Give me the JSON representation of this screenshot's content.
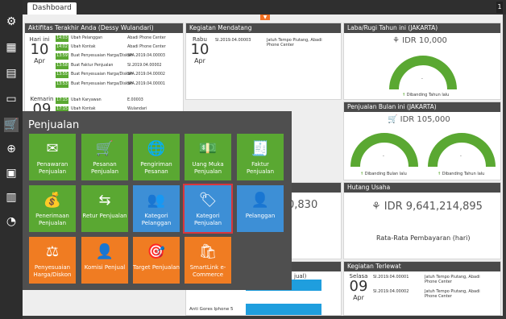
{
  "window": {
    "tab_label": "Dashboard",
    "collapse_glyph": "▼",
    "side_glyph": "1"
  },
  "sidebar": {
    "items": [
      {
        "name": "settings-icon",
        "glyph": "⚙"
      },
      {
        "name": "building-icon",
        "glyph": "▦"
      },
      {
        "name": "calculator-icon",
        "glyph": "▤"
      },
      {
        "name": "wallet-icon",
        "glyph": "▭"
      },
      {
        "name": "cart-icon",
        "glyph": "🛒"
      },
      {
        "name": "cart-add-icon",
        "glyph": "⊕"
      },
      {
        "name": "archive-icon",
        "glyph": "▣"
      },
      {
        "name": "branch-icon",
        "glyph": "▥"
      },
      {
        "name": "pie-chart-icon",
        "glyph": "◔"
      }
    ]
  },
  "activity": {
    "title": "Aktifitas Terakhir Anda (Dessy Wulandari)",
    "day1": {
      "name": "Hari ini",
      "day": "10",
      "month": "Apr"
    },
    "day2": {
      "name": "Kemarin",
      "day": "09",
      "month": "Apr"
    },
    "rows1": [
      {
        "time": "14:03",
        "action": "Ubah Pelanggan",
        "ref": "Abadi Phone Center"
      },
      {
        "time": "14:02",
        "action": "Ubah Kontak",
        "ref": "Abadi Phone Center"
      },
      {
        "time": "13:59",
        "action": "Buat Penyesuaian Harga/Diskon",
        "ref": "SPA.2019.04.00003"
      },
      {
        "time": "13:58",
        "action": "Buat Faktur Penjualan",
        "ref": "SI.2019.04.00002"
      },
      {
        "time": "13:55",
        "action": "Buat Penyesuaian Harga/Diskon",
        "ref": "SPA.2019.04.00002"
      },
      {
        "time": "13:53",
        "action": "Buat Penyesuaian Harga/Diskon",
        "ref": "SPA.2019.04.00001"
      }
    ],
    "rows2": [
      {
        "time": "17:15",
        "action": "Ubah Karyawan",
        "ref": "E.00003"
      },
      {
        "time": "17:15",
        "action": "Ubah Kontak",
        "ref": "Wulandari"
      }
    ]
  },
  "events": {
    "title": "Kegiatan Mendatang",
    "date": {
      "name": "Rabu",
      "day": "10",
      "month": "Apr"
    },
    "item": {
      "ref": "SI.2019.04.00003",
      "desc": "Jatuh Tempo Piutang, Abadi Phone Center"
    }
  },
  "profit": {
    "title": "Laba/Rugi Tahun ini (JAKARTA)",
    "amount": "IDR 10,000",
    "dash": "-",
    "compare": "Dibanding Tahun lalu",
    "arrow": "↑"
  },
  "sales": {
    "title": "Penjualan Bulan ini (JAKARTA)",
    "amount": "IDR 105,000",
    "dash1": "-",
    "dash2": "-",
    "compare1": "Dibanding Bulan lalu",
    "compare2": "Dibanding Tahun lalu",
    "arrow": "↑"
  },
  "debt": {
    "title": "Hutang Usaha",
    "amount": "IDR 9,641,214,895",
    "avg_label": "Rata-Rata Pembayaran (hari)"
  },
  "partial": {
    "amount": "0,830",
    "label": "jual)",
    "item": "Anti Gores Iphone 5"
  },
  "overdue": {
    "title": "Kegiatan Terlewat",
    "date": {
      "name": "Selasa",
      "day": "09",
      "month": "Apr"
    },
    "items": [
      {
        "ref": "SI.2019.04.00001",
        "desc": "Jatuh Tempo Piutang, Abadi Phone Center"
      },
      {
        "ref": "SI.2019.04.00002",
        "desc": "Jatuh Tempo Piutang, Abadi Phone Center"
      }
    ]
  },
  "menu": {
    "title": "Penjualan",
    "tiles": [
      {
        "label": "Penawaran Penjualan",
        "icon": "✉"
      },
      {
        "label": "Pesanan Penjualan",
        "icon": "🛒"
      },
      {
        "label": "Pengiriman Pesanan",
        "icon": "🌐"
      },
      {
        "label": "Uang Muka Penjualan",
        "icon": "💵"
      },
      {
        "label": "Faktur Penjualan",
        "icon": "🧾"
      },
      {
        "label": "Penerimaan Penjualan",
        "icon": "💰"
      },
      {
        "label": "Retur Penjualan",
        "icon": "⇆"
      },
      {
        "label": "Kategori Pelanggan",
        "icon": "👥"
      },
      {
        "label": "Kategori Penjualan",
        "icon": "🏷"
      },
      {
        "label": "Pelanggan",
        "icon": "👤"
      },
      {
        "label": "Penyesuaian Harga/Diskon",
        "icon": "⚖"
      },
      {
        "label": "Komisi Penjual",
        "icon": "👤"
      },
      {
        "label": "Target Penjualan",
        "icon": "🎯"
      },
      {
        "label": "SmartLink e-Commerce",
        "icon": "🛍"
      }
    ]
  },
  "colors": {
    "green": "#5aa832",
    "blue": "#3d8fd6",
    "orange": "#f07c22",
    "selected_outline": "#d9363e"
  }
}
